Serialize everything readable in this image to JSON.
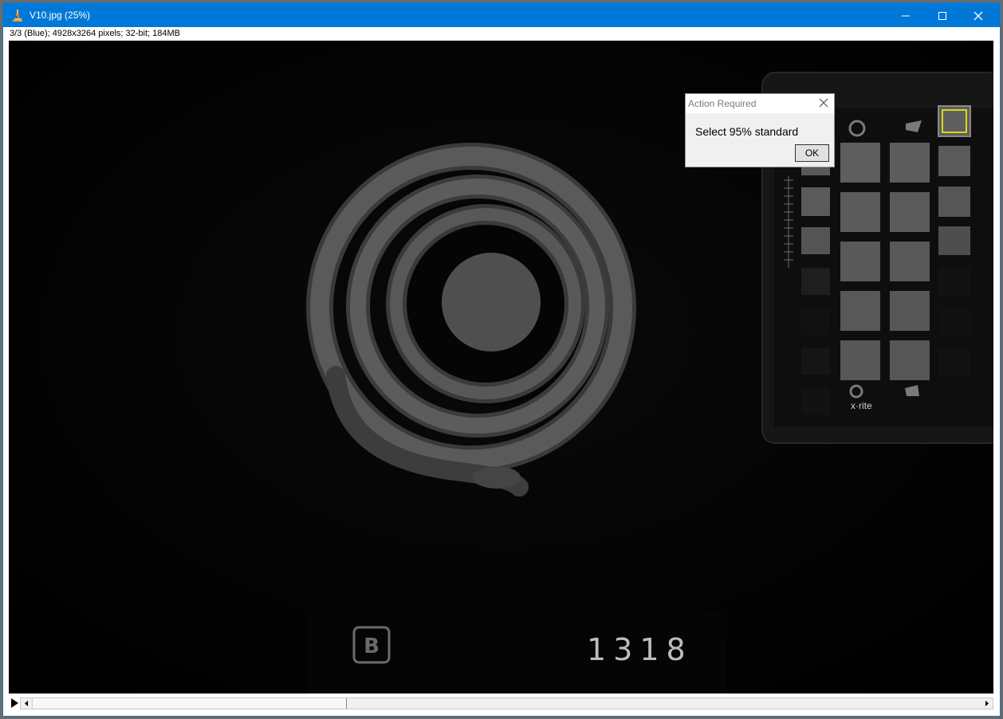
{
  "window": {
    "title": "V10.jpg (25%)",
    "status": "3/3 (Blue); 4928x3264 pixels; 32-bit; 184MB",
    "controls": {
      "minimize": "—",
      "maximize": "☐",
      "close": "✕"
    }
  },
  "image": {
    "number_label": "1318",
    "brand_label": "x·rite"
  },
  "dialog": {
    "title": "Action Required",
    "message": "Select 95% standard",
    "ok_label": "OK"
  },
  "colors": {
    "titlebar": "#0078d7",
    "selection": "#ffff00"
  },
  "icons": [
    "imagej-microscope-icon",
    "minimize-icon",
    "maximize-icon",
    "close-icon",
    "play-icon",
    "scroll-left-icon",
    "scroll-right-icon",
    "dialog-close-icon"
  ]
}
